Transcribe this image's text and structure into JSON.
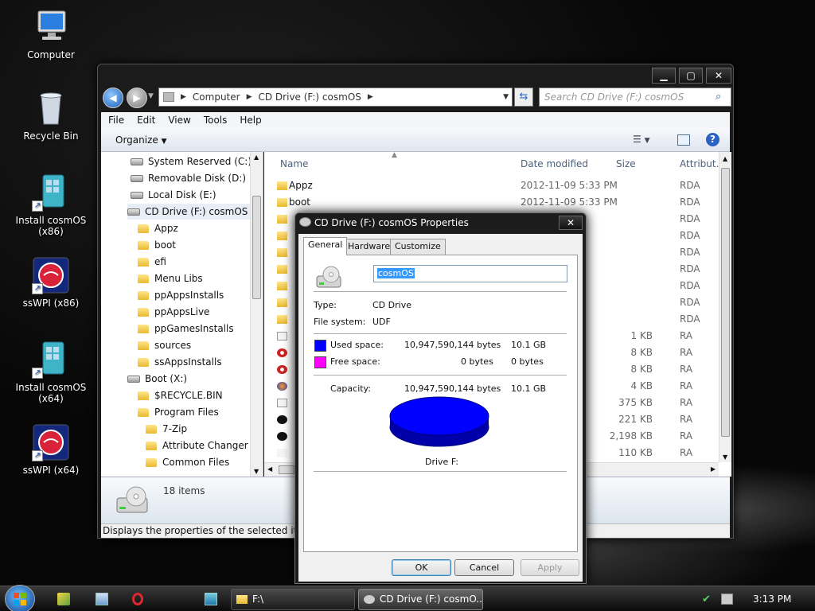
{
  "desktop": {
    "icons": [
      {
        "label": "Computer"
      },
      {
        "label": "Recycle Bin"
      },
      {
        "label": "Install cosmOS (x86)"
      },
      {
        "label": "ssWPI (x86)"
      },
      {
        "label": "Install cosmOS (x64)"
      },
      {
        "label": "ssWPI (x64)"
      }
    ]
  },
  "explorer": {
    "window_controls": {
      "minimize": "▁",
      "maximize": "▢",
      "close": "✕"
    },
    "address": {
      "crumbs": [
        "Computer",
        "CD Drive (F:) cosmOS"
      ]
    },
    "search": {
      "placeholder": "Search CD Drive (F:) cosmOS"
    },
    "menu": [
      "File",
      "Edit",
      "View",
      "Tools",
      "Help"
    ],
    "command_bar": {
      "organize": "Organize"
    },
    "nav_tree": [
      {
        "label": "System Reserved (C:)",
        "type": "drive"
      },
      {
        "label": "Removable Disk (D:)",
        "type": "drive"
      },
      {
        "label": "Local Disk (E:)",
        "type": "drive"
      },
      {
        "label": "CD Drive (F:) cosmOS",
        "type": "drive"
      },
      {
        "label": "Appz",
        "type": "folder"
      },
      {
        "label": "boot",
        "type": "folder"
      },
      {
        "label": "efi",
        "type": "folder"
      },
      {
        "label": "Menu Libs",
        "type": "folder"
      },
      {
        "label": "ppAppsInstalls",
        "type": "folder"
      },
      {
        "label": "ppAppsLive",
        "type": "folder"
      },
      {
        "label": "ppGamesInstalls",
        "type": "folder"
      },
      {
        "label": "sources",
        "type": "folder"
      },
      {
        "label": "ssAppsInstalls",
        "type": "folder"
      },
      {
        "label": "Boot (X:)",
        "type": "drive"
      },
      {
        "label": "$RECYCLE.BIN",
        "type": "folder"
      },
      {
        "label": "Program Files",
        "type": "folder"
      },
      {
        "label": "7-Zip",
        "type": "folder"
      },
      {
        "label": "Attribute Changer",
        "type": "folder"
      },
      {
        "label": "Common Files",
        "type": "folder"
      }
    ],
    "columns": [
      "Name",
      "Date modified",
      "Size",
      "Attribut..."
    ],
    "rows": [
      {
        "name": "Appz",
        "date": "2012-11-09 5:33 PM",
        "size": "",
        "attr": "RDA"
      },
      {
        "name": "boot",
        "date": "2012-11-09 5:33 PM",
        "size": "",
        "attr": "RDA"
      },
      {
        "name": "",
        "date": "PM",
        "size": "",
        "attr": "RDA"
      },
      {
        "name": "",
        "date": "PM",
        "size": "",
        "attr": "RDA"
      },
      {
        "name": "",
        "date": "PM",
        "size": "",
        "attr": "RDA"
      },
      {
        "name": "",
        "date": "PM",
        "size": "",
        "attr": "RDA"
      },
      {
        "name": "",
        "date": "PM",
        "size": "",
        "attr": "RDA"
      },
      {
        "name": "",
        "date": "PM",
        "size": "",
        "attr": "RDA"
      },
      {
        "name": "",
        "date": "PM",
        "size": "",
        "attr": "RDA"
      },
      {
        "name": "",
        "date": "AM",
        "size": "1 KB",
        "attr": "RA"
      },
      {
        "name": "",
        "date": "AM",
        "size": "8 KB",
        "attr": "RA"
      },
      {
        "name": "",
        "date": "AM",
        "size": "8 KB",
        "attr": "RA"
      },
      {
        "name": "",
        "date": "AM",
        "size": "4 KB",
        "attr": "RA"
      },
      {
        "name": "",
        "date": "7 ...",
        "size": "375 KB",
        "attr": "RA"
      },
      {
        "name": "",
        "date": "AM",
        "size": "221 KB",
        "attr": "RA"
      },
      {
        "name": "",
        "date": "AM",
        "size": "2,198 KB",
        "attr": "RA"
      },
      {
        "name": "",
        "date": "AM",
        "size": "110 KB",
        "attr": "RA"
      }
    ],
    "details": {
      "count": "18 items"
    },
    "status": "Displays the properties of the selected items."
  },
  "properties": {
    "title": "CD Drive (F:) cosmOS Properties",
    "close": "✕",
    "tabs": [
      "General",
      "Hardware",
      "Customize"
    ],
    "label_value": "cosmOS",
    "type_label": "Type:",
    "type_value": "CD Drive",
    "fs_label": "File system:",
    "fs_value": "UDF",
    "used_label": "Used space:",
    "used_bytes": "10,947,590,144 bytes",
    "used_gb": "10.1 GB",
    "free_label": "Free space:",
    "free_bytes": "0 bytes",
    "free_gb": "0 bytes",
    "capacity_label": "Capacity:",
    "capacity_bytes": "10,947,590,144 bytes",
    "capacity_gb": "10.1 GB",
    "drive_caption": "Drive F:",
    "used_color": "#0000ff",
    "free_color": "#ff00ff",
    "buttons": {
      "ok": "OK",
      "cancel": "Cancel",
      "apply": "Apply"
    }
  },
  "taskbar": {
    "buttons": [
      {
        "label": "F:\\"
      },
      {
        "label": "CD Drive (F:) cosmO..."
      }
    ],
    "clock": "3:13 PM"
  }
}
